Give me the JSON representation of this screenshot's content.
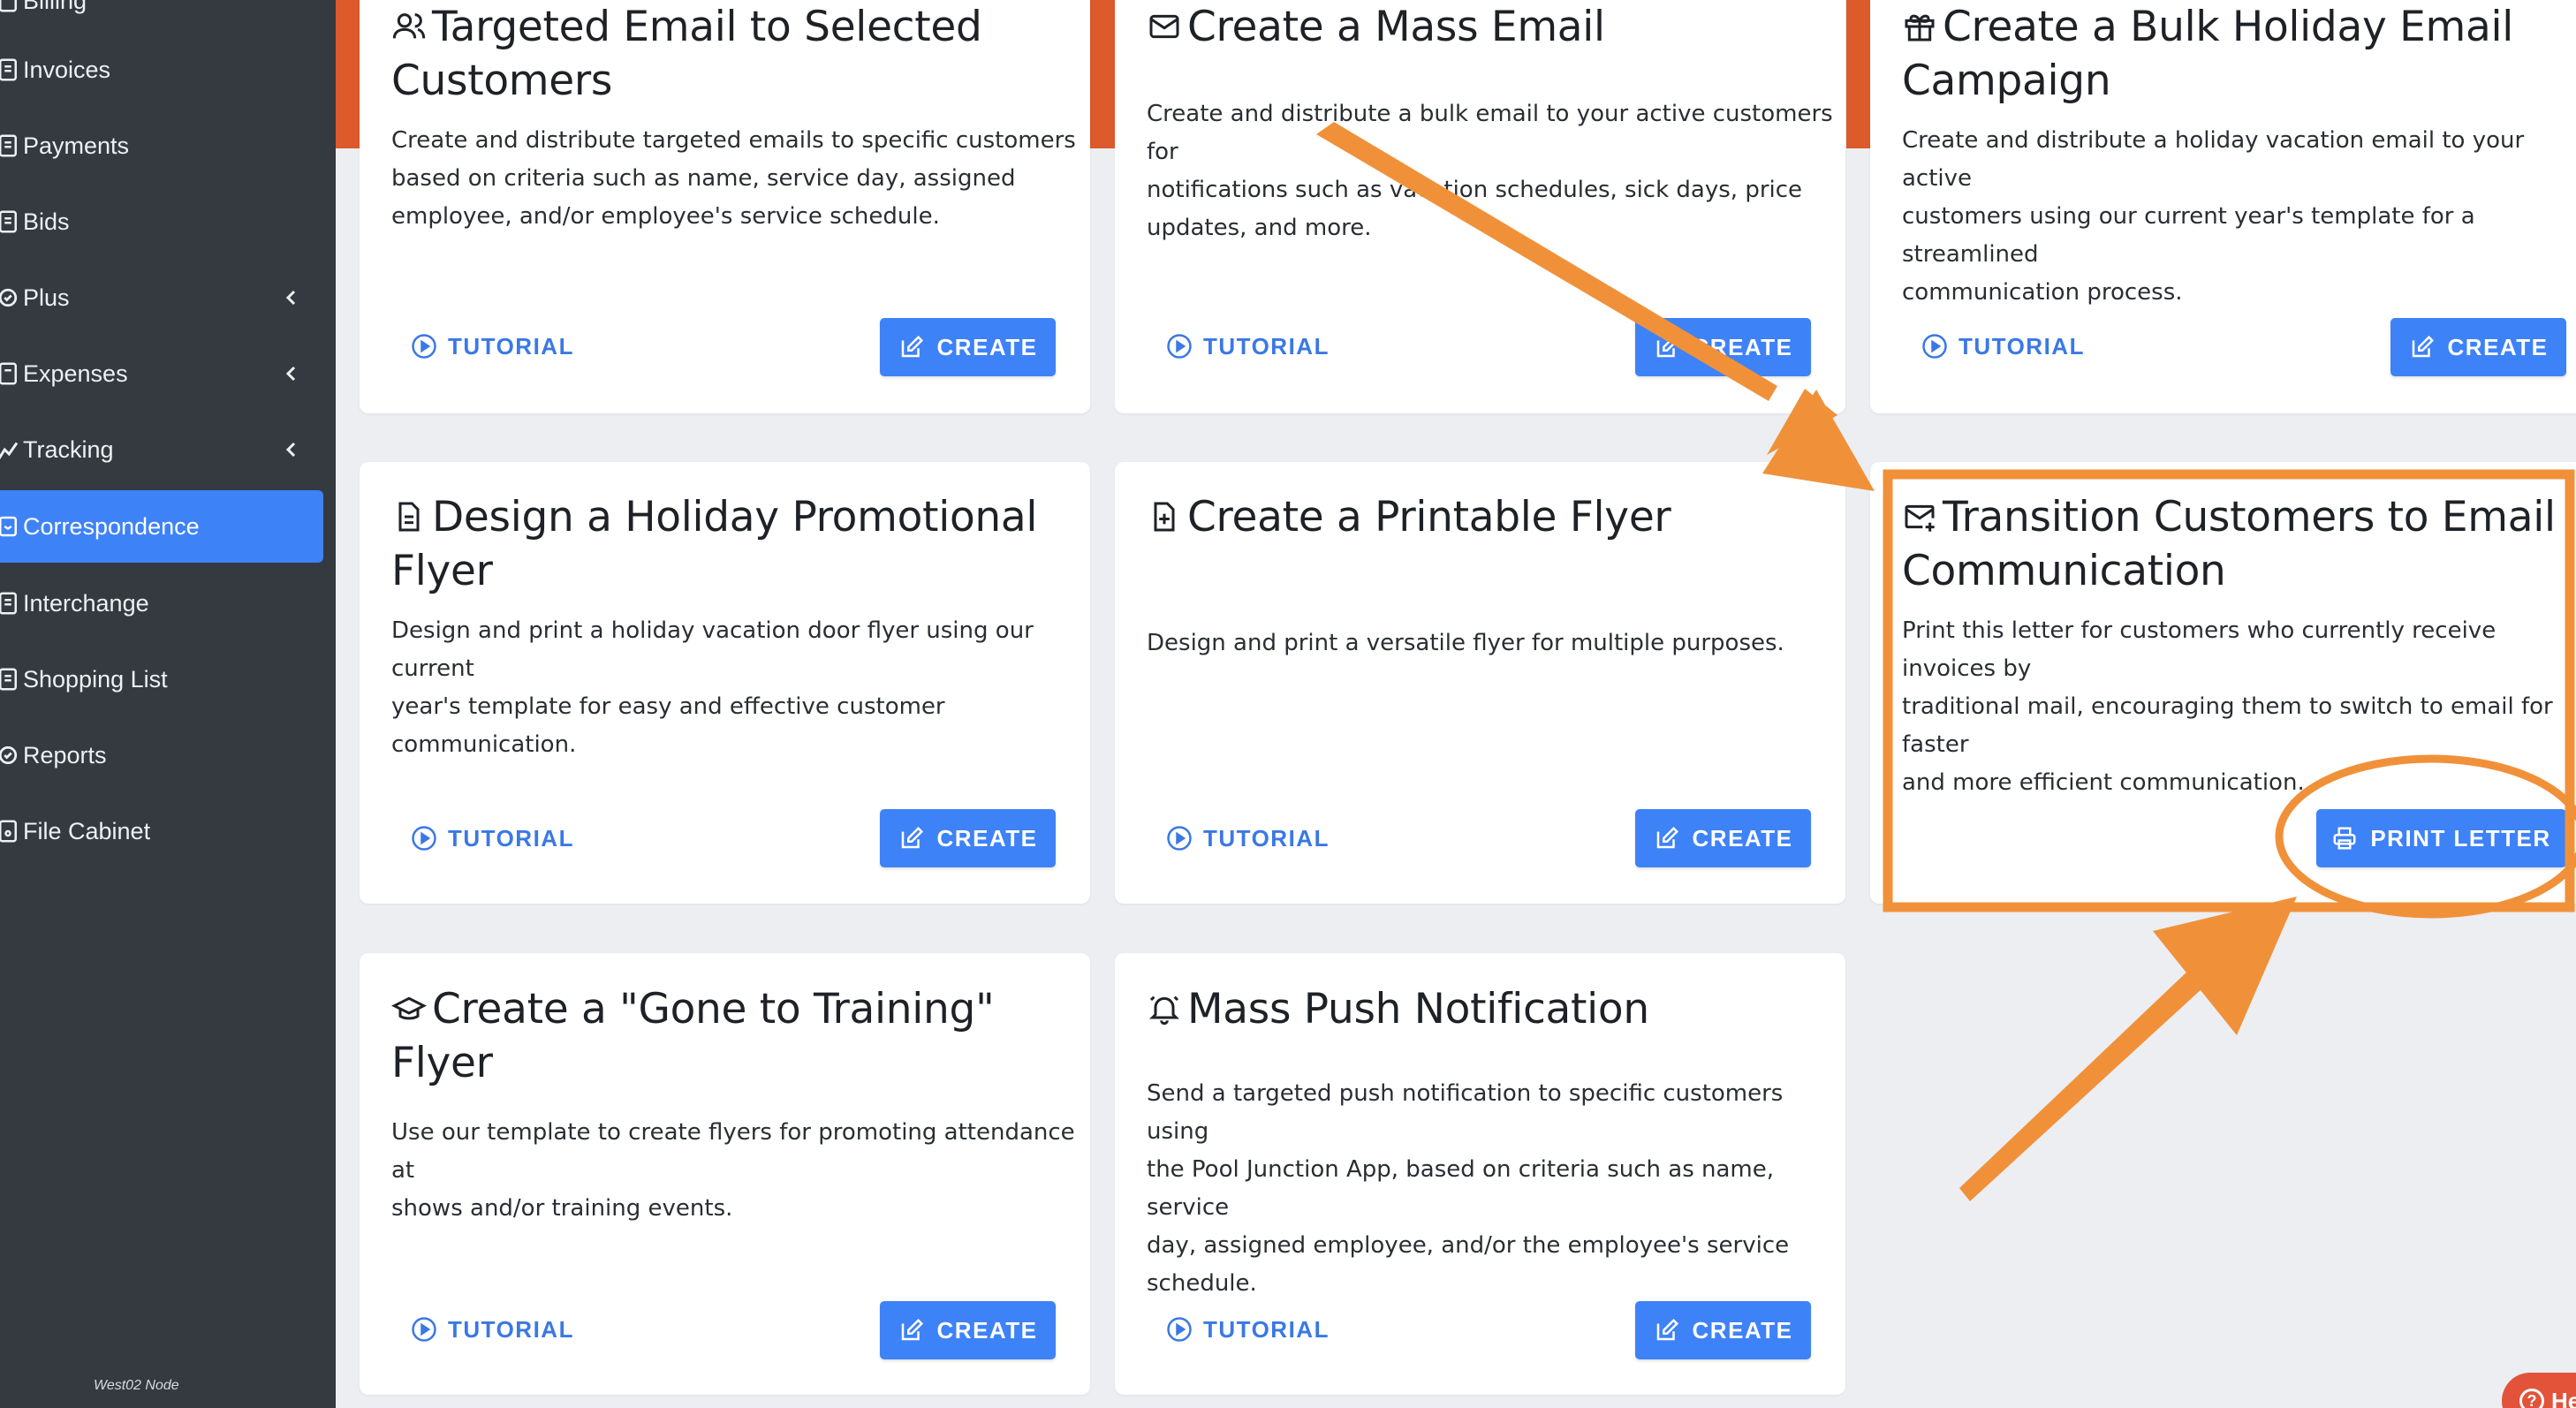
{
  "sidebar": {
    "items": [
      {
        "label": "Billing",
        "icon": "billing-icon"
      },
      {
        "label": "Invoices",
        "icon": "invoice-icon"
      },
      {
        "label": "Payments",
        "icon": "payment-icon"
      },
      {
        "label": "Bids",
        "icon": "bid-icon"
      },
      {
        "label": "Plus",
        "icon": "plus-icon",
        "expandable": true
      },
      {
        "label": "Expenses",
        "icon": "expense-icon",
        "expandable": true
      },
      {
        "label": "Tracking",
        "icon": "tracking-icon",
        "expandable": true
      },
      {
        "label": "Correspondence",
        "icon": "correspondence-icon",
        "active": true
      },
      {
        "label": "Interchange",
        "icon": "interchange-icon"
      },
      {
        "label": "Shopping List",
        "icon": "shopping-list-icon"
      },
      {
        "label": "Reports",
        "icon": "reports-icon"
      },
      {
        "label": "File Cabinet",
        "icon": "file-cabinet-icon"
      }
    ],
    "node_label": "West02 Node"
  },
  "cards": {
    "targeted_email": {
      "title_line1": "Targeted Email to Selected",
      "title_line2": "Customers",
      "icon": "users-icon",
      "desc_lines": [
        "Create and distribute targeted emails to specific customers",
        "based on criteria such as name, service day, assigned",
        "employee, and/or employee's service schedule."
      ],
      "tutorial": "TUTORIAL",
      "action": "CREATE"
    },
    "mass_email": {
      "title_line1": "Create a Mass Email",
      "icon": "mail-icon",
      "desc_lines": [
        "Create and distribute a bulk email to your active customers for",
        "notifications such as vacation schedules, sick days, price",
        "updates, and more."
      ],
      "tutorial": "TUTORIAL",
      "action": "CREATE"
    },
    "bulk_holiday": {
      "title_line1": "Create a Bulk Holiday Email",
      "title_line2": "Campaign",
      "icon": "gift-icon",
      "desc_lines": [
        "Create and distribute a holiday vacation email to your active",
        "customers using our current year's template for a streamlined",
        "communication process."
      ],
      "tutorial": "TUTORIAL",
      "action": "CREATE"
    },
    "holiday_flyer": {
      "title_line1": "Design a Holiday Promotional",
      "title_line2": "Flyer",
      "icon": "document-icon",
      "desc_lines": [
        "Design and print a holiday vacation door flyer using our current",
        "year's template for easy and effective customer",
        "communication."
      ],
      "tutorial": "TUTORIAL",
      "action": "CREATE"
    },
    "printable_flyer": {
      "title_line1": "Create a Printable Flyer",
      "icon": "file-plus-icon",
      "desc_lines": [
        "Design and print a versatile flyer for multiple purposes."
      ],
      "tutorial": "TUTORIAL",
      "action": "CREATE"
    },
    "transition": {
      "title_line1": "Transition Customers to Email",
      "title_line2": "Communication",
      "icon": "mail-plus-icon",
      "desc_lines": [
        "Print this letter for customers who currently receive invoices by",
        "traditional mail, encouraging them to switch to email for faster",
        "and more efficient communication."
      ],
      "action": "PRINT LETTER"
    },
    "training_flyer": {
      "title_line1": "Create a \"Gone to Training\" Flyer",
      "icon": "graduation-cap-icon",
      "desc_lines": [
        "Use our template to create flyers for promoting attendance at",
        "shows and/or training events."
      ],
      "tutorial": "TUTORIAL",
      "action": "CREATE"
    },
    "push_notification": {
      "title_line1": "Mass Push Notification",
      "icon": "bell-icon",
      "desc_lines": [
        "Send a targeted push notification to specific customers using",
        "the Pool Junction App, based on criteria such as name, service",
        "day, assigned employee, and/or the employee's service",
        "schedule."
      ],
      "tutorial": "TUTORIAL",
      "action": "CREATE"
    }
  },
  "help": {
    "label": "He"
  },
  "colors": {
    "sidebar_bg": "#343a40",
    "accent_blue": "#3e82f7",
    "annotation_orange": "#f0913a",
    "header_accent": "#dd5a2b"
  }
}
